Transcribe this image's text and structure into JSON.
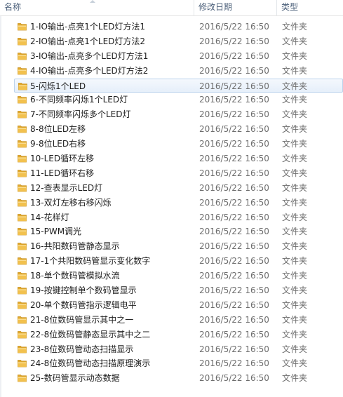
{
  "columns": {
    "name": "名称",
    "date": "修改日期",
    "type": "类型"
  },
  "colors": {
    "folder": "#f2c14e",
    "selection_border": "#bcd3ec",
    "header_text": "#4c607a"
  },
  "icon": "folder-icon",
  "files": [
    {
      "name": "1-IO输出-点亮1个LED灯方法1",
      "date": "2016/5/22 16:50",
      "type": "文件夹"
    },
    {
      "name": "2-IO输出-点亮1个LED灯方法2",
      "date": "2016/5/22 16:50",
      "type": "文件夹"
    },
    {
      "name": "3-IO输出-点亮多个LED灯方法1",
      "date": "2016/5/22 16:50",
      "type": "文件夹"
    },
    {
      "name": "4-IO输出-点亮多个LED灯方法2",
      "date": "2016/5/22 16:50",
      "type": "文件夹"
    },
    {
      "name": "5-闪烁1个LED",
      "date": "2016/5/22 16:50",
      "type": "文件夹"
    },
    {
      "name": "6-不同频率闪烁1个LED灯",
      "date": "2016/5/22 16:50",
      "type": "文件夹"
    },
    {
      "name": "7-不同频率闪烁多个LED灯",
      "date": "2016/5/22 16:50",
      "type": "文件夹"
    },
    {
      "name": "8-8位LED左移",
      "date": "2016/5/22 16:50",
      "type": "文件夹"
    },
    {
      "name": "9-8位LED右移",
      "date": "2016/5/22 16:50",
      "type": "文件夹"
    },
    {
      "name": "10-LED循环左移",
      "date": "2016/5/22 16:50",
      "type": "文件夹"
    },
    {
      "name": "11-LED循环右移",
      "date": "2016/5/22 16:50",
      "type": "文件夹"
    },
    {
      "name": "12-查表显示LED灯",
      "date": "2016/5/22 16:50",
      "type": "文件夹"
    },
    {
      "name": "13-双灯左移右移闪烁",
      "date": "2016/5/22 16:50",
      "type": "文件夹"
    },
    {
      "name": "14-花样灯",
      "date": "2016/5/22 16:50",
      "type": "文件夹"
    },
    {
      "name": "15-PWM调光",
      "date": "2016/5/22 16:50",
      "type": "文件夹"
    },
    {
      "name": "16-共阳数码管静态显示",
      "date": "2016/5/22 16:50",
      "type": "文件夹"
    },
    {
      "name": "17-1个共阳数码管显示变化数字",
      "date": "2016/5/22 16:50",
      "type": "文件夹"
    },
    {
      "name": "18-单个数码管模拟水流",
      "date": "2016/5/22 16:50",
      "type": "文件夹"
    },
    {
      "name": "19-按键控制单个数码管显示",
      "date": "2016/5/22 16:50",
      "type": "文件夹"
    },
    {
      "name": "20-单个数码管指示逻辑电平",
      "date": "2016/5/22 16:50",
      "type": "文件夹"
    },
    {
      "name": "21-8位数码管显示其中之一",
      "date": "2016/5/22 16:50",
      "type": "文件夹"
    },
    {
      "name": "22-8位数码管静态显示其中之二",
      "date": "2016/5/22 16:50",
      "type": "文件夹"
    },
    {
      "name": "23-8位数码管动态扫描显示",
      "date": "2016/5/22 16:50",
      "type": "文件夹"
    },
    {
      "name": "24-8位数码管动态扫描原理演示",
      "date": "2016/5/22 16:50",
      "type": "文件夹"
    },
    {
      "name": "25-数码管显示动态数据",
      "date": "2016/5/22 16:50",
      "type": "文件夹"
    }
  ],
  "selected_index": 4
}
